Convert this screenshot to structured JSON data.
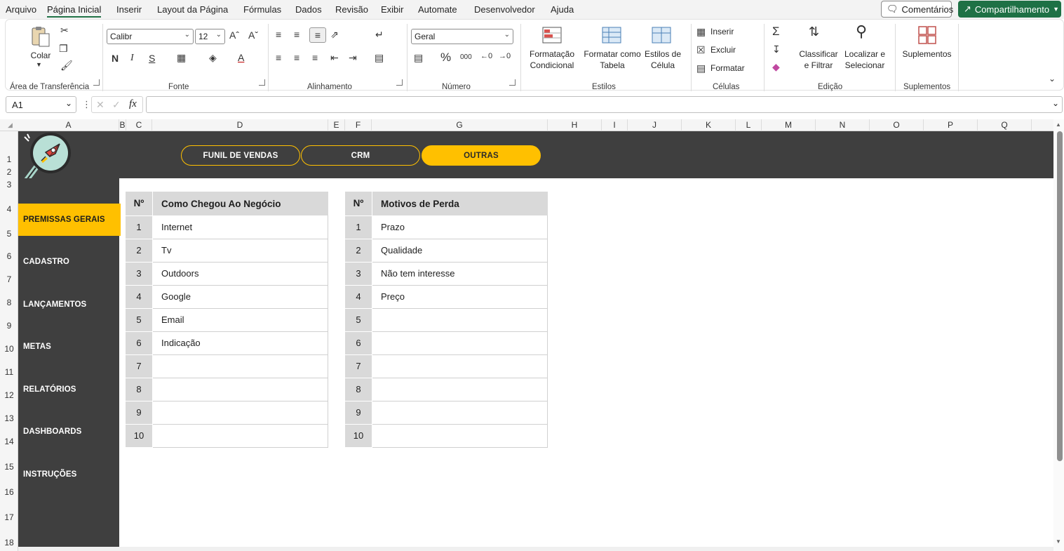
{
  "menu": {
    "items": [
      "Arquivo",
      "Página Inicial",
      "Inserir",
      "Layout da Página",
      "Fórmulas",
      "Dados",
      "Revisão",
      "Exibir",
      "Automate",
      "Desenvolvedor",
      "Ajuda"
    ],
    "comments": "Comentários",
    "share": "Compartilhamento"
  },
  "ribbon": {
    "clipboard": {
      "paste": "Colar",
      "group": "Área de Transferência"
    },
    "font": {
      "name": "Calibr",
      "size": "12",
      "bold": "N",
      "italic": "I",
      "underline": "S",
      "group": "Fonte"
    },
    "alignment": {
      "group": "Alinhamento"
    },
    "number": {
      "format": "Geral",
      "percent": "%",
      "thousands": "000",
      "group": "Número"
    },
    "styles": {
      "conditional_1": "Formatação",
      "conditional_2": "Condicional",
      "table_1": "Formatar como",
      "table_2": "Tabela",
      "cell_1": "Estilos de",
      "cell_2": "Célula",
      "group": "Estilos"
    },
    "cells": {
      "insert": "Inserir",
      "delete": "Excluir",
      "format": "Formatar",
      "group": "Células"
    },
    "editing": {
      "sort_1": "Classificar",
      "sort_2": "e Filtrar",
      "find_1": "Localizar e",
      "find_2": "Selecionar",
      "group": "Edição"
    },
    "addins": {
      "label": "Suplementos",
      "group": "Suplementos"
    }
  },
  "formula_bar": {
    "cell_ref": "A1",
    "fx": "fx",
    "formula": ""
  },
  "columns": [
    "A",
    "B",
    "C",
    "D",
    "E",
    "F",
    "G",
    "H",
    "I",
    "J",
    "K",
    "L",
    "M",
    "N",
    "O",
    "P",
    "Q"
  ],
  "rows": [
    "1",
    "2",
    "3",
    "4",
    "5",
    "6",
    "7",
    "8",
    "9",
    "10",
    "11",
    "12",
    "13",
    "14",
    "15",
    "16",
    "17",
    "18"
  ],
  "top_tabs": [
    {
      "label": "FUNIL DE VENDAS",
      "active": false
    },
    {
      "label": "CRM",
      "active": false
    },
    {
      "label": "OUTRAS",
      "active": true
    }
  ],
  "sidebar": [
    {
      "label": "PREMISSAS GERAIS",
      "active": true
    },
    {
      "label": "CADASTRO",
      "active": false
    },
    {
      "label": "LANÇAMENTOS",
      "active": false
    },
    {
      "label": "METAS",
      "active": false
    },
    {
      "label": "RELATÓRIOS",
      "active": false
    },
    {
      "label": "DASHBOARDS",
      "active": false
    },
    {
      "label": "INSTRUÇÕES",
      "active": false
    }
  ],
  "table_origin": {
    "num_header": "Nº",
    "title": "Como Chegou Ao Negócio",
    "rows": [
      {
        "n": "1",
        "value": "Internet"
      },
      {
        "n": "2",
        "value": "Tv"
      },
      {
        "n": "3",
        "value": "Outdoors"
      },
      {
        "n": "4",
        "value": "Google"
      },
      {
        "n": "5",
        "value": "Email"
      },
      {
        "n": "6",
        "value": "Indicação"
      },
      {
        "n": "7",
        "value": ""
      },
      {
        "n": "8",
        "value": ""
      },
      {
        "n": "9",
        "value": ""
      },
      {
        "n": "10",
        "value": ""
      }
    ]
  },
  "table_loss": {
    "num_header": "Nº",
    "title": "Motivos de Perda",
    "rows": [
      {
        "n": "1",
        "value": "Prazo"
      },
      {
        "n": "2",
        "value": "Qualidade"
      },
      {
        "n": "3",
        "value": "Não tem interesse"
      },
      {
        "n": "4",
        "value": "Preço"
      },
      {
        "n": "5",
        "value": ""
      },
      {
        "n": "6",
        "value": ""
      },
      {
        "n": "7",
        "value": ""
      },
      {
        "n": "8",
        "value": ""
      },
      {
        "n": "9",
        "value": ""
      },
      {
        "n": "10",
        "value": ""
      }
    ]
  },
  "colors": {
    "accent": "#ffc000",
    "dark": "#3f3f3f",
    "excel_green": "#1e7145"
  }
}
